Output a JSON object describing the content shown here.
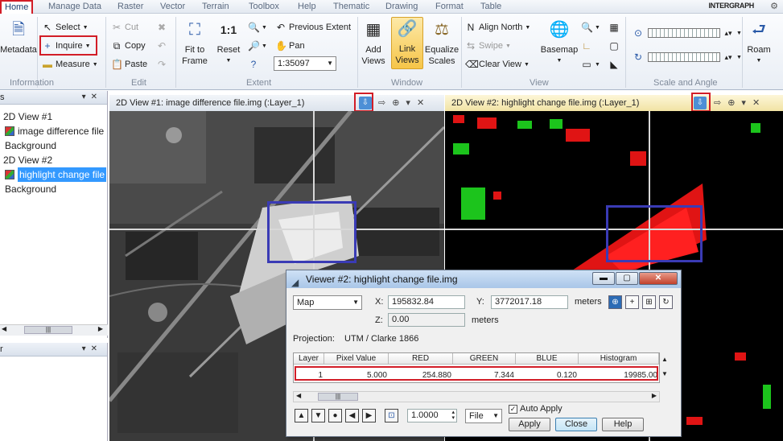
{
  "menu": {
    "tabs": [
      "Home",
      "Manage Data",
      "Raster",
      "Vector",
      "Terrain",
      "Toolbox",
      "Help",
      "Thematic",
      "Drawing",
      "Format",
      "Table"
    ],
    "brand": "INTERGRAPH"
  },
  "ribbon": {
    "metadata": "Metadata",
    "select": "Select",
    "inquire": "Inquire",
    "measure": "Measure",
    "cut": "Cut",
    "copy": "Copy",
    "paste": "Paste",
    "fit_to_frame_1": "Fit to",
    "fit_to_frame_2": "Frame",
    "reset": "Reset",
    "previous_extent": "Previous Extent",
    "pan": "Pan",
    "scale_value": "1:35097",
    "add_views_1": "Add",
    "add_views_2": "Views",
    "link_views_1": "Link",
    "link_views_2": "Views",
    "equalize_1": "Equalize",
    "equalize_2": "Scales",
    "align_north": "Align North",
    "swipe": "Swipe",
    "clear_view": "Clear View",
    "basemap": "Basemap",
    "roam": "Roam",
    "groups": [
      "Information",
      "Edit",
      "Extent",
      "Window",
      "View",
      "Scale and Angle"
    ]
  },
  "contents_panel": {
    "items": [
      "2D View #1",
      "image difference file",
      "Background",
      "2D View #2",
      "highlight change file",
      "Background"
    ]
  },
  "views": {
    "view1_title": "2D View #1: image difference file.img (:Layer_1)",
    "view2_title": "2D View #2: highlight change file.img (:Layer_1)"
  },
  "viewer": {
    "title": "Viewer #2:  highlight change file.img",
    "coord_system": "Map",
    "x_label": "X:",
    "x_value": "195832.84",
    "y_label": "Y:",
    "y_value": "3772017.18",
    "xy_units": "meters",
    "z_label": "Z:",
    "z_value": "0.00",
    "z_units": "meters",
    "projection_label": "Projection:",
    "projection_value": "UTM / Clarke 1866",
    "table_headers": [
      "Layer",
      "Pixel Value",
      "RED",
      "GREEN",
      "BLUE",
      "Histogram"
    ],
    "table_row": [
      "1",
      "5.000",
      "254.880",
      "7.344",
      "0.120",
      "19985.00"
    ],
    "step_value": "1.0000",
    "file_option": "File",
    "auto_apply": "Auto Apply",
    "apply": "Apply",
    "close": "Close",
    "help": "Help"
  }
}
